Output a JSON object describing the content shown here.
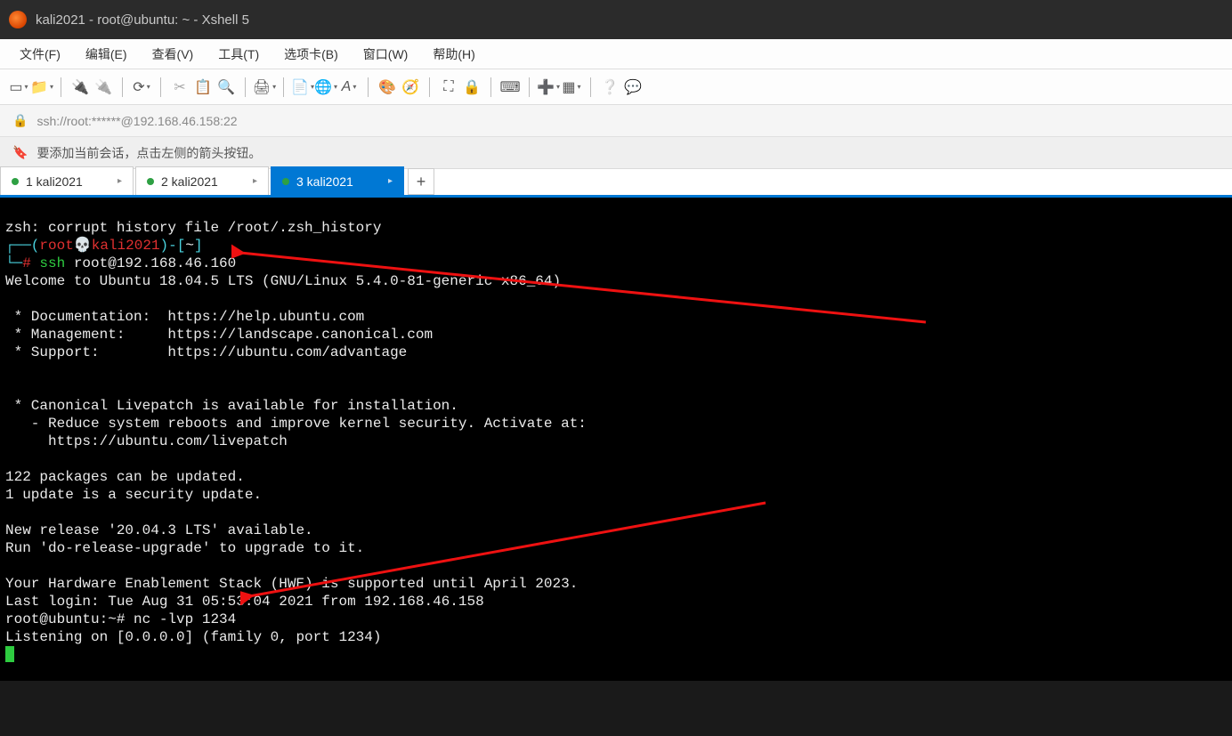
{
  "window": {
    "title": "kali2021 - root@ubuntu: ~ - Xshell 5"
  },
  "menu": {
    "file": "文件(F)",
    "edit": "编辑(E)",
    "view": "查看(V)",
    "tools": "工具(T)",
    "tabs": "选项卡(B)",
    "window": "窗口(W)",
    "help": "帮助(H)"
  },
  "address": {
    "url": "ssh://root:******@192.168.46.158:22"
  },
  "hint": {
    "text": "要添加当前会话，点击左侧的箭头按钮。"
  },
  "tabs": {
    "t1": "1 kali2021",
    "t2": "2 kali2021",
    "t3": "3 kali2021",
    "plus": "+"
  },
  "term": {
    "l1": "zsh: corrupt history file /root/.zsh_history",
    "prompt_open": "┌──(",
    "prompt_user": "root💀kali2021",
    "prompt_close": ")-[",
    "prompt_path": "~",
    "prompt_end": "]",
    "prompt_line2": "└─",
    "prompt_hash": "# ",
    "ssh_cmd": "ssh",
    "ssh_args": " root@192.168.46.160",
    "welcome": "Welcome to Ubuntu 18.04.5 LTS (GNU/Linux 5.4.0-81-generic x86_64)",
    "doc1": " * Documentation:  https://help.ubuntu.com",
    "doc2": " * Management:     https://landscape.canonical.com",
    "doc3": " * Support:        https://ubuntu.com/advantage",
    "lp1": " * Canonical Livepatch is available for installation.",
    "lp2": "   - Reduce system reboots and improve kernel security. Activate at:",
    "lp3": "     https://ubuntu.com/livepatch",
    "pkg1": "122 packages can be updated.",
    "pkg2": "1 update is a security update.",
    "rel1": "New release '20.04.3 LTS' available.",
    "rel2": "Run 'do-release-upgrade' to upgrade to it.",
    "hwe": "Your Hardware Enablement Stack (HWE) is supported until April 2023.",
    "last": "Last login: Tue Aug 31 05:53:04 2021 from 192.168.46.158",
    "ub_prompt": "root@ubuntu:~# ",
    "nc_cmd": "nc -lvp 1234",
    "listen": "Listening on [0.0.0.0] (family 0, port 1234)"
  }
}
